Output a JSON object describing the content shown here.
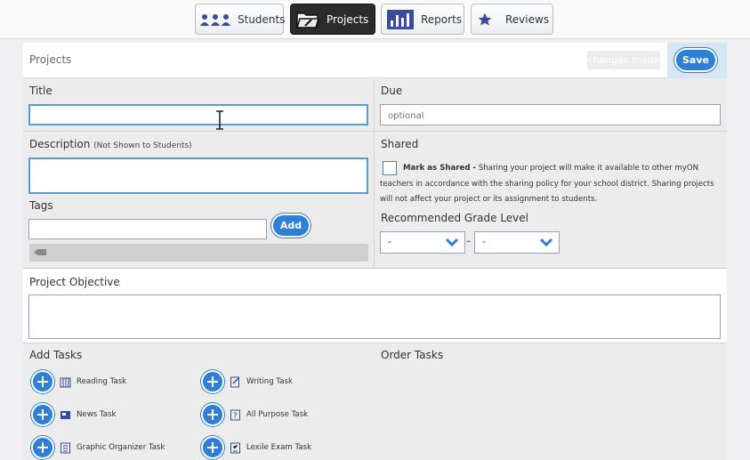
{
  "nav": {
    "tabs": [
      {
        "label": "Students",
        "icon": "students-icon"
      },
      {
        "label": "Projects",
        "icon": "projects-folder-icon",
        "active": true
      },
      {
        "label": "Reports",
        "icon": "reports-chart-icon"
      },
      {
        "label": "Reviews",
        "icon": "star-icon"
      }
    ]
  },
  "header": {
    "title": "Projects",
    "changes_label": "changes made",
    "save_label": "Save"
  },
  "form": {
    "title_label": "Title",
    "title_value": "",
    "due_label": "Due",
    "due_placeholder": "optional",
    "description_label": "Description",
    "description_note": "(Not Shown to Students)",
    "tags_label": "Tags",
    "add_label": "Add",
    "shared_label": "Shared",
    "mark_shared_label": "Mark as Shared -",
    "shared_text": "Sharing your project will make it available to other myON teachers in accordance with the sharing policy for your school district. Sharing projects will not affect your project or its assignment to students.",
    "grade_label": "Recommended Grade Level",
    "grade_from": "-",
    "grade_sep": "–",
    "grade_to": "-",
    "objective_label": "Project Objective"
  },
  "tasks": {
    "add_label": "Add Tasks",
    "order_label": "Order Tasks",
    "items": [
      {
        "label": "Reading Task",
        "icon": "books-icon"
      },
      {
        "label": "Writing Task",
        "icon": "pencil-paper-icon"
      },
      {
        "label": "News Task",
        "icon": "newspaper-icon"
      },
      {
        "label": "All Purpose Task",
        "icon": "question-doc-icon"
      },
      {
        "label": "Graphic Organizer Task",
        "icon": "organizer-doc-icon"
      },
      {
        "label": "Lexile Exam Task",
        "icon": "exam-doc-icon"
      }
    ]
  },
  "colors": {
    "accent": "#2f7fd6",
    "focus": "#5b9bd5",
    "nav_icon": "#3b4a9c"
  }
}
